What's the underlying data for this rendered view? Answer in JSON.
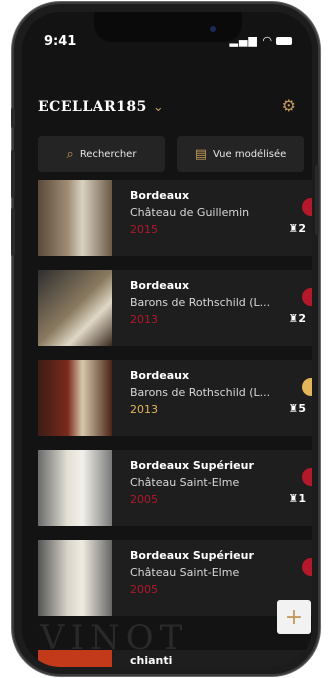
{
  "status": {
    "time": "9:41",
    "icons": "..ıl ≈"
  },
  "header": {
    "cellar_name": "ECELLAR185"
  },
  "toolbar": {
    "search_label": "Rechercher",
    "view_label": "Vue modélisée"
  },
  "wines": [
    {
      "region": "Bordeaux",
      "producer": "Château de Guillemin",
      "vintage": "2015",
      "count": "2",
      "color": "#b3182b"
    },
    {
      "region": "Bordeaux",
      "producer": "Barons de Rothschild (L...",
      "vintage": "2013",
      "count": "2",
      "color": "#b3182b"
    },
    {
      "region": "Bordeaux",
      "producer": "Barons de Rothschild (L...",
      "vintage": "2013",
      "count": "5",
      "color": "#e3b65a"
    },
    {
      "region": "Bordeaux Supérieur",
      "producer": "Château Saint-Elme",
      "vintage": "2005",
      "count": "1",
      "color": "#b3182b"
    },
    {
      "region": "Bordeaux Supérieur",
      "producer": "Château Saint-Elme",
      "vintage": "2005",
      "count": "",
      "color": "#b3182b"
    }
  ],
  "last_row": {
    "region": "chianti"
  },
  "watermark": "VINOT",
  "fab_label": "+"
}
